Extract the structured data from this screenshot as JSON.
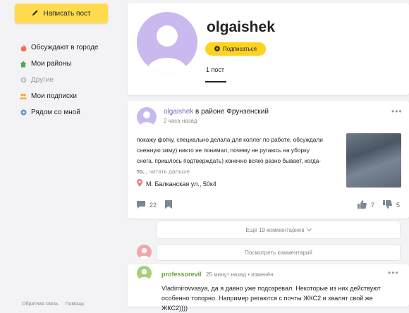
{
  "sidebar": {
    "write_label": "Написать пост",
    "items": [
      {
        "label": "Обсуждают в городе",
        "icon": "fire-icon"
      },
      {
        "label": "Мои районы",
        "icon": "home-icon"
      },
      {
        "label": "Другие",
        "icon": "plus-circle-icon"
      },
      {
        "label": "Мои подписки",
        "icon": "people-icon"
      },
      {
        "label": "Рядом со мной",
        "icon": "location-icon"
      }
    ],
    "footer": [
      "Обратная связь",
      "Помощь"
    ]
  },
  "profile": {
    "username": "olgaishek",
    "subscribe_label": "Подписаться",
    "posts_tab": "1 пост"
  },
  "post": {
    "author": "olgaishek",
    "district": "в районе Фрунзенский",
    "time": "2 часа назад",
    "text": "покажу фотку, специально делала для коллег по работе, обсуждали снежную зиму) никто не понимал, почему не ругаюсь на уборку снега, пришлось подтверждать) конечно всяко разно бывает, когда-то...",
    "read_more": "читать дальше",
    "location": "М. Балканская ул., 50к4",
    "comments_count": "22",
    "likes": "7",
    "dislikes": "5"
  },
  "comments": {
    "more_label": "Ещё 19 комментариев",
    "input_placeholder": "Посмотреть комментарий",
    "items": [
      {
        "author": "professorevil",
        "meta": "25 минут назад • изменён",
        "text": "Vladimirovvasya, да я давно уже подозревал. Некоторые из них действуют особенно топорно. Например регаются с почты ЖКС2 и хвалят свой же ЖКС2))))"
      }
    ]
  },
  "colors": {
    "accent_yellow": "#ffdb4d",
    "author_purple": "#7d66c5",
    "commenter_green": "#6aa33c"
  }
}
